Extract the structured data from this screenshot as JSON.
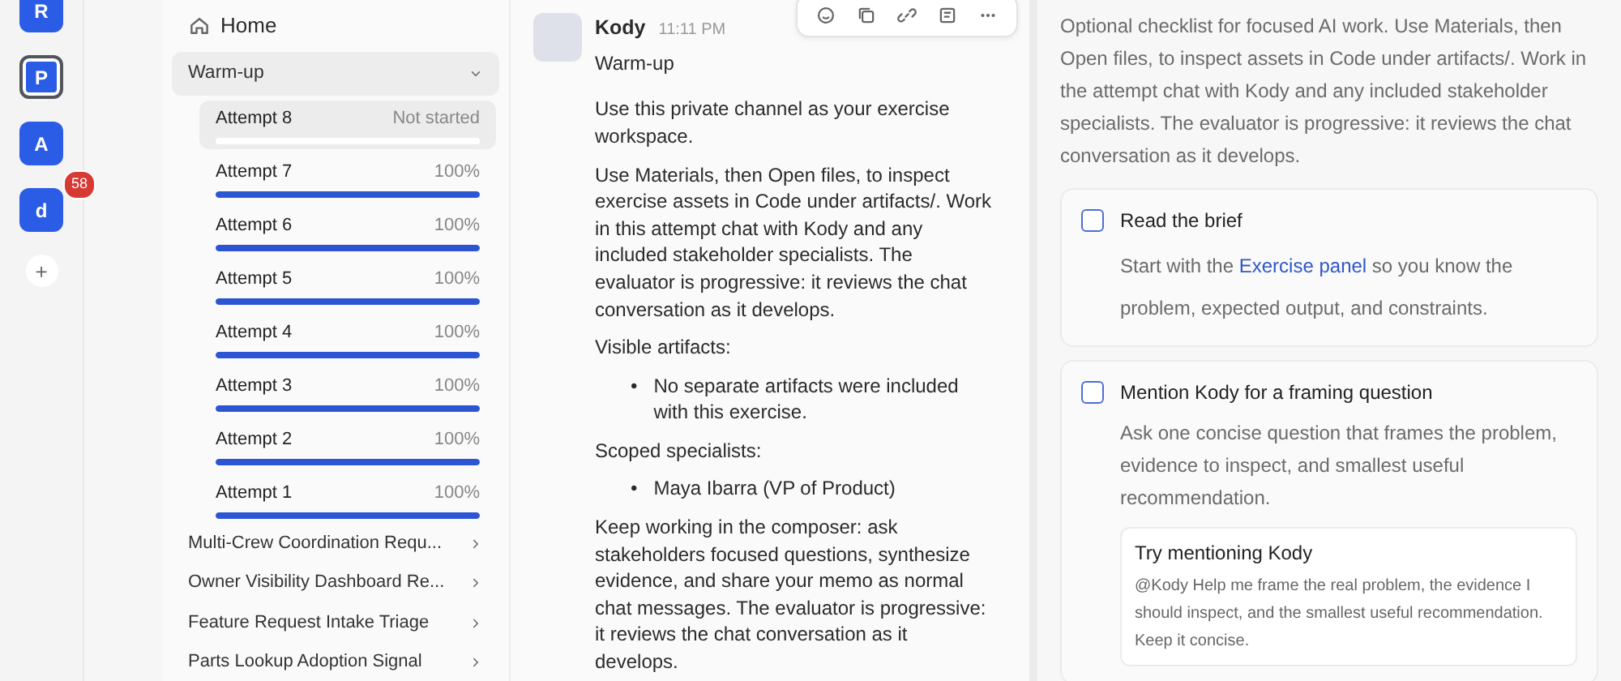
{
  "rail": [
    {
      "letter": "R",
      "selected": false
    },
    {
      "letter": "P",
      "selected": true
    },
    {
      "letter": "A",
      "selected": false
    },
    {
      "letter": "d",
      "selected": false,
      "badge": "58"
    }
  ],
  "rail_add": "+",
  "sidebar": {
    "home": "Home",
    "group": {
      "label": "Warm-up",
      "expanded": true,
      "attempts": [
        {
          "label": "Attempt 8",
          "status": "Not started",
          "level": 0,
          "selected": true
        },
        {
          "label": "Attempt 7",
          "status": "100%",
          "level": 1,
          "selected": false
        },
        {
          "label": "Attempt 6",
          "status": "100%",
          "level": 1,
          "selected": false
        },
        {
          "label": "Attempt 5",
          "status": "100%",
          "level": 1,
          "selected": false
        },
        {
          "label": "Attempt 4",
          "status": "100%",
          "level": 1,
          "selected": false
        },
        {
          "label": "Attempt 3",
          "status": "100%",
          "level": 1,
          "selected": false
        },
        {
          "label": "Attempt 2",
          "status": "100%",
          "level": 1,
          "selected": false
        },
        {
          "label": "Attempt 1",
          "status": "100%",
          "level": 1,
          "selected": false
        }
      ]
    },
    "items": [
      "Multi-Crew Coordination Requ...",
      "Owner Visibility Dashboard Re...",
      "Feature Request Intake Triage",
      "Parts Lookup Adoption Signal"
    ]
  },
  "message": {
    "author": "Kody",
    "time": "11:11 PM",
    "blocks": [
      {
        "kind": "text",
        "text": "Warm-up"
      },
      {
        "kind": "text",
        "text": "Use this private channel as your exercise workspace."
      },
      {
        "kind": "text",
        "text": "Use Materials, then Open files, to inspect exercise assets in Code under artifacts/. Work in this attempt chat with Kody and any included stakeholder specialists. The evaluator is progressive: it reviews the chat conversation as it develops."
      },
      {
        "kind": "text",
        "text": "Visible artifacts:"
      },
      {
        "kind": "bullets",
        "marker": "•",
        "items": [
          "No separate artifacts were included with this exercise."
        ]
      },
      {
        "kind": "text",
        "text": "Scoped specialists:"
      },
      {
        "kind": "bullets",
        "marker": "•",
        "items": [
          "Maya Ibarra (VP of Product)"
        ]
      },
      {
        "kind": "text",
        "text": "Keep working in the composer: ask stakeholders focused questions, synthesize evidence, and share your memo as normal chat messages. The evaluator is progressive: it reviews the chat conversation as it develops."
      }
    ]
  },
  "panel": {
    "intro": "Optional checklist for focused AI work. Use Materials, then Open files, to inspect assets in Code under artifacts/. Work in the attempt chat with Kody and any included stakeholder specialists. The evaluator is progressive: it reviews the chat conversation as it develops.",
    "tasks": [
      {
        "title": "Read the brief",
        "checked": false,
        "before": "Start with the ",
        "link": "Exercise panel",
        "after": " so you know the problem, expected output, and constraints."
      },
      {
        "title": "Mention Kody for a framing question",
        "checked": false,
        "before": "Ask one concise question that frames the problem, evidence to inspect, and smallest useful recommendation.",
        "hint": {
          "title": "Try mentioning Kody",
          "text": "@Kody Help me frame the real problem, the evidence I should inspect, and the smallest useful recommendation. Keep it concise."
        }
      }
    ]
  }
}
